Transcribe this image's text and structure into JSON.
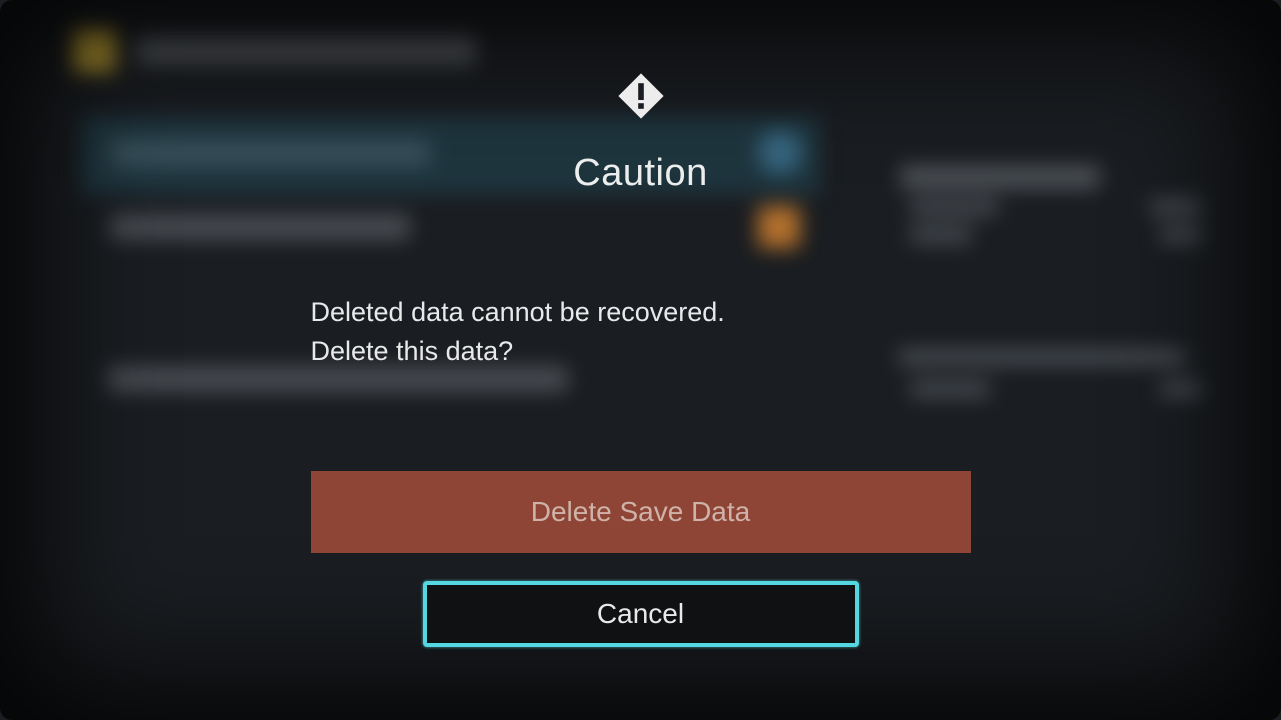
{
  "dialog": {
    "title": "Caution",
    "message": "Deleted data cannot be recovered.\nDelete this data?",
    "delete_label": "Delete Save Data",
    "cancel_label": "Cancel"
  },
  "colors": {
    "accent": "#54d7e0",
    "danger_bg": "#8e4535"
  }
}
